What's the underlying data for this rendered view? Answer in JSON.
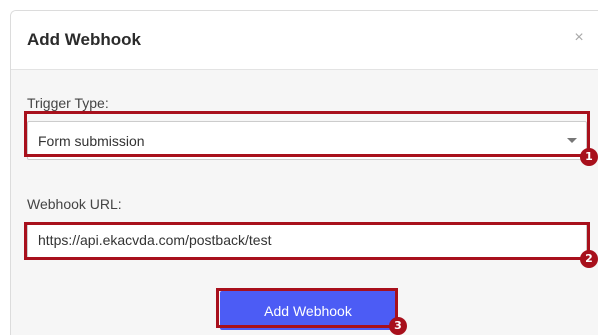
{
  "dialog": {
    "title": "Add Webhook",
    "close_icon": "close-icon",
    "close_glyph": "×"
  },
  "trigger": {
    "label": "Trigger Type:",
    "selected": "Form submission",
    "arrow_icon": "chevron-down-icon"
  },
  "webhook": {
    "label": "Webhook URL:",
    "value": "https://api.ekacvda.com/postback/test"
  },
  "submit": {
    "label": "Add Webhook"
  },
  "annotations": {
    "color": "#a8101c",
    "badges": [
      "1",
      "2",
      "3"
    ]
  },
  "colors": {
    "button": "#4c5cf5",
    "body_background": "#f6f6f6"
  }
}
